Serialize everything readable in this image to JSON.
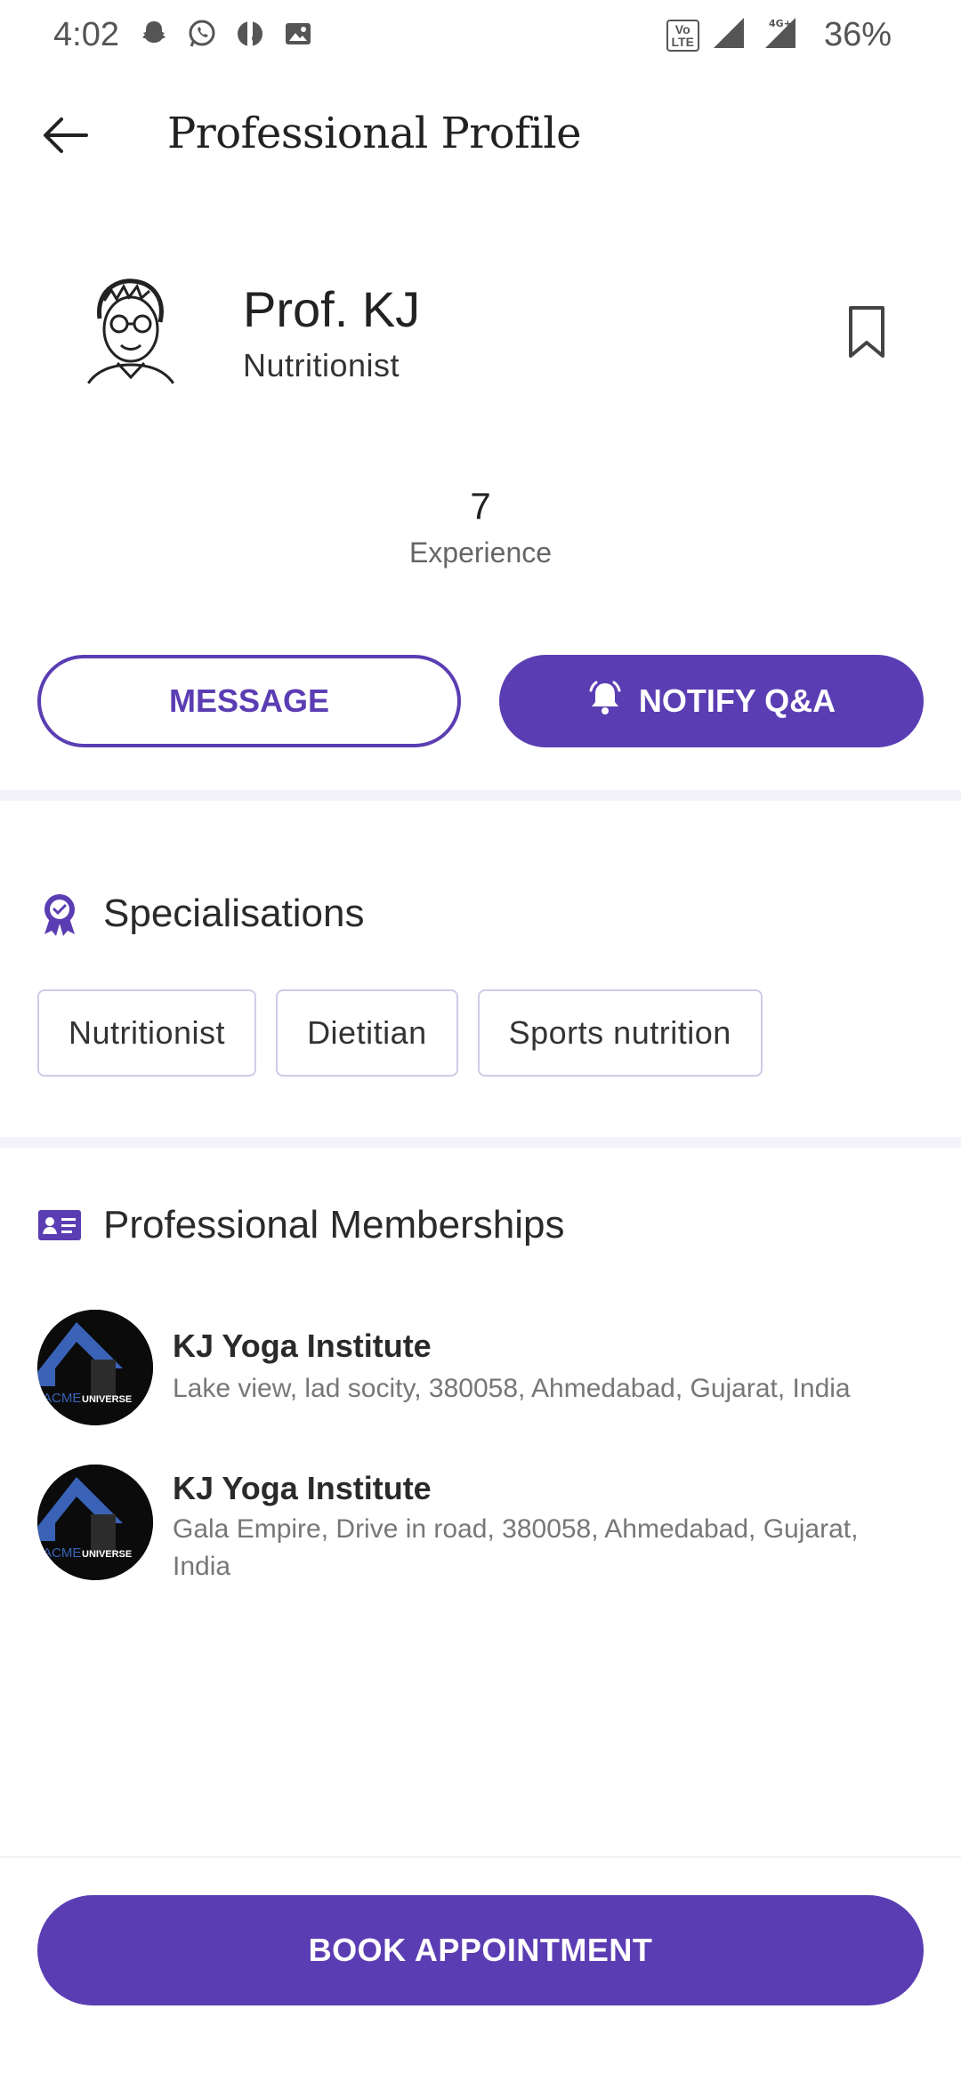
{
  "status_bar": {
    "time": "4:02",
    "battery": "36%",
    "network": "4G+",
    "volte": "Vo LTE 2"
  },
  "header": {
    "title": "Professional Profile",
    "back_icon": "arrow-left-icon"
  },
  "profile": {
    "name": "Prof. KJ",
    "role": "Nutritionist",
    "bookmark_icon": "bookmark-icon"
  },
  "stats": {
    "experience_value": "7",
    "experience_label": "Experience"
  },
  "actions": {
    "message_label": "MESSAGE",
    "notify_label": "NOTIFY Q&A",
    "notify_icon": "bell-icon"
  },
  "specialisations": {
    "title": "Specialisations",
    "icon": "badge-icon",
    "items": [
      "Nutritionist",
      "Dietitian",
      "Sports nutrition"
    ]
  },
  "memberships": {
    "title": "Professional Memberships",
    "icon": "id-card-icon",
    "items": [
      {
        "name": "KJ Yoga Institute",
        "address": "Lake view, lad socity, 380058, Ahmedabad, Gujarat, India",
        "logo_text": "ACME UNIVERSE"
      },
      {
        "name": "KJ Yoga Institute",
        "address": "Gala Empire, Drive in road, 380058, Ahmedabad, Gujarat, India",
        "logo_text": "ACME UNIVERSE"
      }
    ]
  },
  "footer": {
    "book_label": "BOOK APPOINTMENT"
  },
  "colors": {
    "accent": "#5b3db3",
    "separator": "#f4f3fb",
    "chip_border": "#cfcbe6"
  }
}
